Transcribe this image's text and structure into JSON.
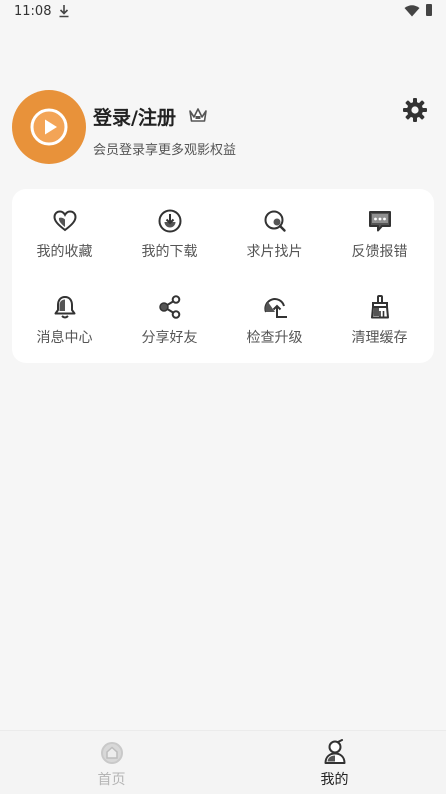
{
  "status_bar": {
    "time": "11:08"
  },
  "profile": {
    "title": "登录/注册",
    "subtitle": "会员登录享更多观影权益"
  },
  "grid": [
    {
      "label": "我的收藏",
      "icon": "heart-icon"
    },
    {
      "label": "我的下载",
      "icon": "download-icon"
    },
    {
      "label": "求片找片",
      "icon": "search-film-icon"
    },
    {
      "label": "反馈报错",
      "icon": "feedback-icon"
    },
    {
      "label": "消息中心",
      "icon": "bell-icon"
    },
    {
      "label": "分享好友",
      "icon": "share-icon"
    },
    {
      "label": "检查升级",
      "icon": "upgrade-icon"
    },
    {
      "label": "清理缓存",
      "icon": "broom-icon"
    }
  ],
  "nav": {
    "home": "首页",
    "mine": "我的",
    "active": "mine"
  },
  "colors": {
    "accent": "#e8923a",
    "background": "#f6f6f6",
    "card": "#ffffff",
    "text": "#222222",
    "muted": "#555555"
  }
}
